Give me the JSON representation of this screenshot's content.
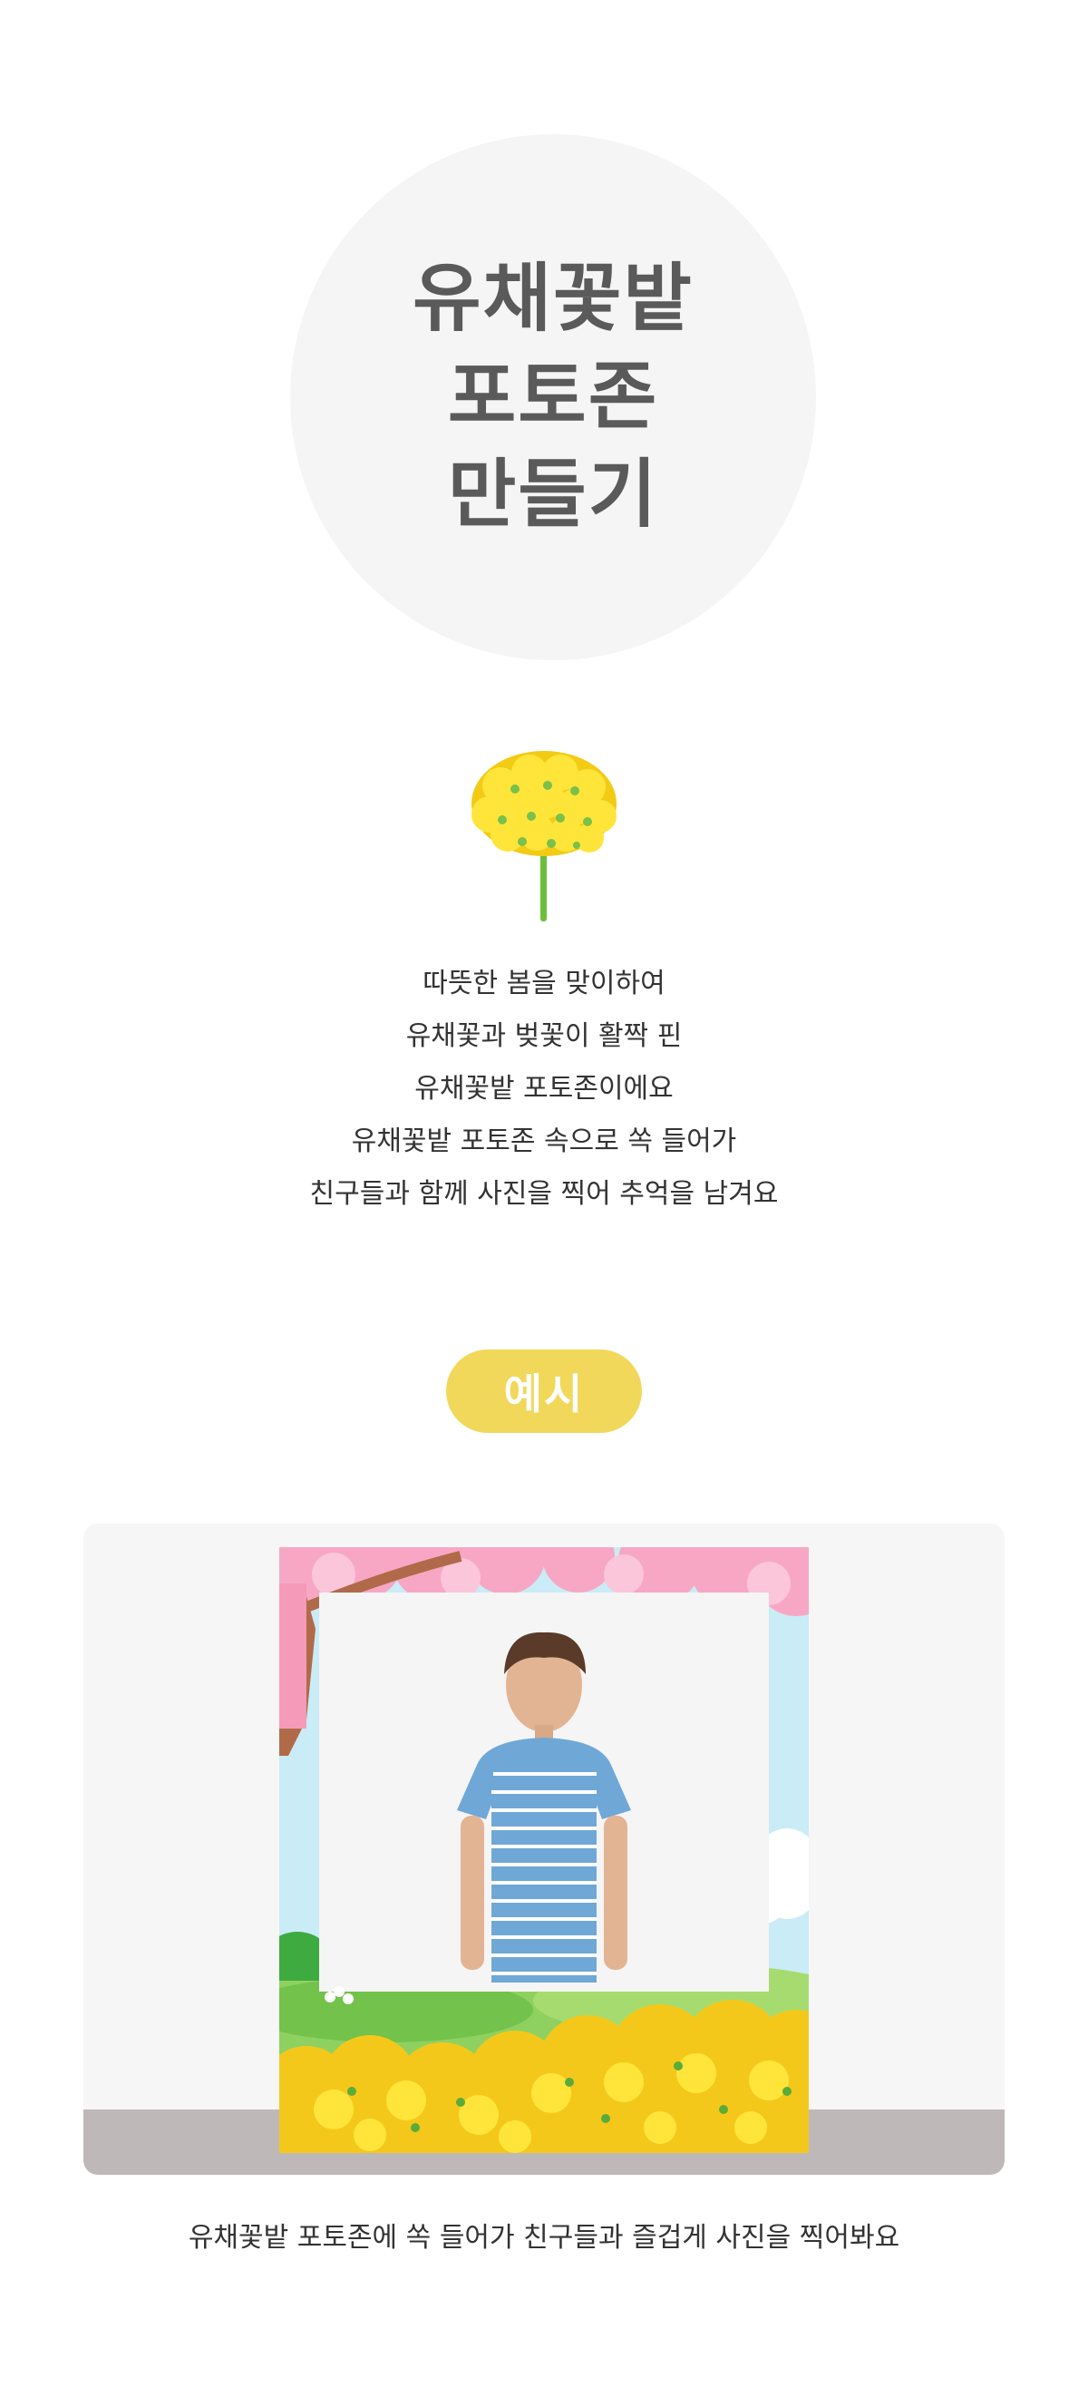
{
  "title": {
    "lines": [
      "유채꽃밭",
      "포토존",
      "만들기"
    ]
  },
  "description": {
    "lines": [
      "따뜻한 봄을 맞이하여",
      "유채꽃과 벚꽃이 활짝 핀",
      "유채꽃밭 포토존이에요",
      "유채꽃밭 포토존 속으로 쏙 들어가",
      "친구들과 함께 사진을 찍어 추억을 남겨요"
    ]
  },
  "example": {
    "badge_label": "예시",
    "caption": "유채꽃밭 포토존에 쏙 들어가 친구들과 즐겁게 사진을 찍어봐요"
  },
  "colors": {
    "badge": "#f2d85a",
    "title_text": "#5a5a5a",
    "circle_bg": "#f5f5f5",
    "flower_yellow": "#f7d81c",
    "stem_green": "#6cbf3b",
    "cherry_pink": "#f7a7c4",
    "sky_blue": "#c9ecf7"
  }
}
